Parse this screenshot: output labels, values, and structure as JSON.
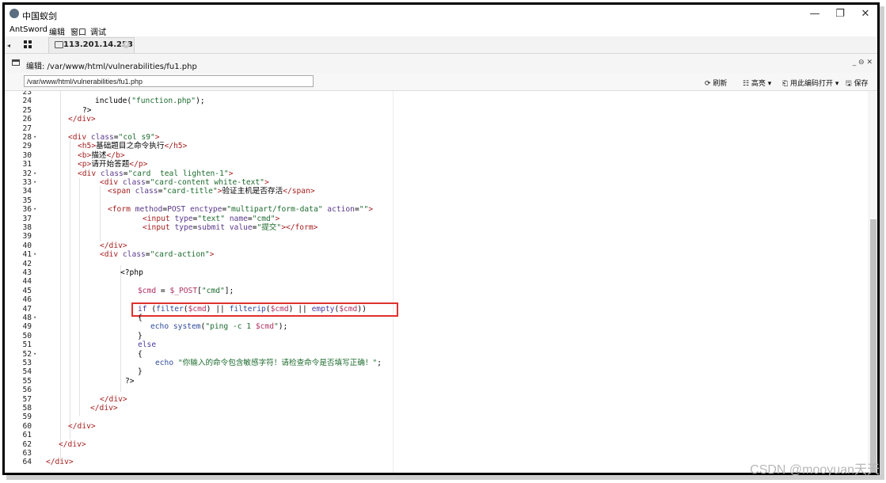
{
  "window": {
    "title": "中国蚁剑",
    "minimize": "—",
    "restore": "❐",
    "close": "✕"
  },
  "menu": [
    "AntSword",
    "编辑",
    "窗口",
    "调试"
  ],
  "tab": {
    "label": "113.201.14.253",
    "close": "✕"
  },
  "editor": {
    "title": "编辑: /var/www/html/vulnerabilities/fu1.php",
    "window_tools": "_ ⊖ ✕",
    "path_value": "/var/www/html/vulnerabilities/fu1.php"
  },
  "toolbar": {
    "refresh": "⟳ 刷新",
    "highlight": "☷ 高亮 ▾",
    "open_with_encoding": "⎗ 用此编码打开 ▾",
    "save": "🖫 保存"
  },
  "code_lines": [
    {
      "n": "23",
      "fold": "",
      "indent": 0,
      "html": ""
    },
    {
      "n": "24",
      "fold": "",
      "indent": 68,
      "html": "include(<span class=\"str\">\"function.php\"</span>);"
    },
    {
      "n": "25",
      "fold": "",
      "indent": 52,
      "html": "?>"
    },
    {
      "n": "26",
      "fold": "",
      "indent": 34,
      "html": "<span class=\"tag\">&lt;/div&gt;</span>"
    },
    {
      "n": "27",
      "fold": "",
      "indent": 0,
      "html": ""
    },
    {
      "n": "28",
      "fold": "▾",
      "indent": 34,
      "html": "<span class=\"tag\">&lt;div</span> <span class=\"attr\">class</span>=<span class=\"str\">\"col s9\"</span><span class=\"tag\">&gt;</span>"
    },
    {
      "n": "29",
      "fold": "",
      "indent": 46,
      "html": "<span class=\"tag\">&lt;h5&gt;</span>基础题目之命令执行<span class=\"tag\">&lt;/h5&gt;</span>"
    },
    {
      "n": "30",
      "fold": "",
      "indent": 46,
      "html": "<span class=\"tag\">&lt;b&gt;</span>描述<span class=\"tag\">&lt;/b&gt;</span>"
    },
    {
      "n": "31",
      "fold": "",
      "indent": 46,
      "html": "<span class=\"tag\">&lt;p&gt;</span>请开始答题<span class=\"tag\">&lt;/p&gt;</span>"
    },
    {
      "n": "32",
      "fold": "▾",
      "indent": 46,
      "html": "<span class=\"tag\">&lt;div</span> <span class=\"attr\">class</span>=<span class=\"str\">\"card  teal lighten-1\"</span><span class=\"tag\">&gt;</span>"
    },
    {
      "n": "33",
      "fold": "▾",
      "indent": 74,
      "html": "<span class=\"tag\">&lt;div</span> <span class=\"attr\">class</span>=<span class=\"str\">\"card-content white-text\"</span><span class=\"tag\">&gt;</span>"
    },
    {
      "n": "34",
      "fold": "",
      "indent": 84,
      "html": "<span class=\"tag\">&lt;span</span> <span class=\"attr\">class</span>=<span class=\"str\">\"card-title\"</span><span class=\"tag\">&gt;</span>验证主机是否存活<span class=\"tag\">&lt;/span&gt;</span>"
    },
    {
      "n": "35",
      "fold": "",
      "indent": 0,
      "html": ""
    },
    {
      "n": "36",
      "fold": "▾",
      "indent": 84,
      "html": "<span class=\"tag\">&lt;form</span> <span class=\"attr\">method</span>=<span class=\"attr\">POST</span> <span class=\"attr\">enctype</span>=<span class=\"str\">\"multipart/form-data\"</span> <span class=\"attr\">action</span>=<span class=\"str\">\"\"</span><span class=\"tag\">&gt;</span>"
    },
    {
      "n": "37",
      "fold": "",
      "indent": 128,
      "html": "<span class=\"tag\">&lt;input</span> <span class=\"attr\">type</span>=<span class=\"str\">\"text\"</span> <span class=\"attr\">name</span>=<span class=\"str\">\"cmd\"</span><span class=\"tag\">&gt;</span>"
    },
    {
      "n": "38",
      "fold": "",
      "indent": 128,
      "html": "<span class=\"tag\">&lt;input</span> <span class=\"attr\">type</span>=<span class=\"attr\">submit</span> <span class=\"attr\">value</span>=<span class=\"str\">\"提交\"</span><span class=\"tag\">&gt;&lt;/form&gt;</span>"
    },
    {
      "n": "39",
      "fold": "",
      "indent": 0,
      "html": ""
    },
    {
      "n": "40",
      "fold": "",
      "indent": 74,
      "html": "<span class=\"tag\">&lt;/div&gt;</span>"
    },
    {
      "n": "41",
      "fold": "▾",
      "indent": 74,
      "html": "<span class=\"tag\">&lt;div</span> <span class=\"attr\">class</span>=<span class=\"str\">\"card-action\"</span><span class=\"tag\">&gt;</span>"
    },
    {
      "n": "42",
      "fold": "",
      "indent": 0,
      "html": ""
    },
    {
      "n": "43",
      "fold": "",
      "indent": 100,
      "html": "&lt;?php"
    },
    {
      "n": "44",
      "fold": "",
      "indent": 0,
      "html": ""
    },
    {
      "n": "45",
      "fold": "",
      "indent": 122,
      "html": "<span class=\"var\">$cmd</span> = <span class=\"var\">$_POST</span>[<span class=\"str\">\"cmd\"</span>];"
    },
    {
      "n": "46",
      "fold": "",
      "indent": 0,
      "html": ""
    },
    {
      "n": "47",
      "fold": "",
      "indent": 122,
      "html": "<span class=\"kw\">if</span> (<span class=\"fn\">filter</span>(<span class=\"var\">$cmd</span>) || <span class=\"fn\">filterip</span>(<span class=\"var\">$cmd</span>) || <span class=\"kw\">empty</span>(<span class=\"var\">$cmd</span>))"
    },
    {
      "n": "48",
      "fold": "▾",
      "indent": 122,
      "html": "{"
    },
    {
      "n": "49",
      "fold": "",
      "indent": 138,
      "html": "<span class=\"fn\">echo</span> <span class=\"fn\">system</span>(<span class=\"str\">\"ping -c 1 <span class=\"var\">$cmd</span>\"</span>);"
    },
    {
      "n": "50",
      "fold": "",
      "indent": 122,
      "html": "}"
    },
    {
      "n": "51",
      "fold": "",
      "indent": 122,
      "html": "<span class=\"kw\">else</span>"
    },
    {
      "n": "52",
      "fold": "▾",
      "indent": 122,
      "html": "{"
    },
    {
      "n": "53",
      "fold": "",
      "indent": 144,
      "html": "<span class=\"fn\">echo</span> <span class=\"str\">\"你输入的命令包含敏感字符！请检查命令是否填写正确！\"</span>;"
    },
    {
      "n": "54",
      "fold": "",
      "indent": 122,
      "html": "}"
    },
    {
      "n": "55",
      "fold": "",
      "indent": 106,
      "html": "?>"
    },
    {
      "n": "56",
      "fold": "",
      "indent": 0,
      "html": ""
    },
    {
      "n": "57",
      "fold": "",
      "indent": 74,
      "html": "<span class=\"tag\">&lt;/div&gt;</span>"
    },
    {
      "n": "58",
      "fold": "",
      "indent": 62,
      "html": "<span class=\"tag\">&lt;/div&gt;</span>"
    },
    {
      "n": "59",
      "fold": "",
      "indent": 0,
      "html": ""
    },
    {
      "n": "60",
      "fold": "",
      "indent": 34,
      "html": "<span class=\"tag\">&lt;/div&gt;</span>"
    },
    {
      "n": "61",
      "fold": "",
      "indent": 0,
      "html": ""
    },
    {
      "n": "62",
      "fold": "",
      "indent": 22,
      "html": "<span class=\"tag\">&lt;/div&gt;</span>"
    },
    {
      "n": "63",
      "fold": "",
      "indent": 0,
      "html": ""
    },
    {
      "n": "64",
      "fold": "",
      "indent": 6,
      "html": "<span class=\"tag\">&lt;/div&gt;</span>"
    }
  ],
  "watermark": "CSDN @mooyuan天天"
}
